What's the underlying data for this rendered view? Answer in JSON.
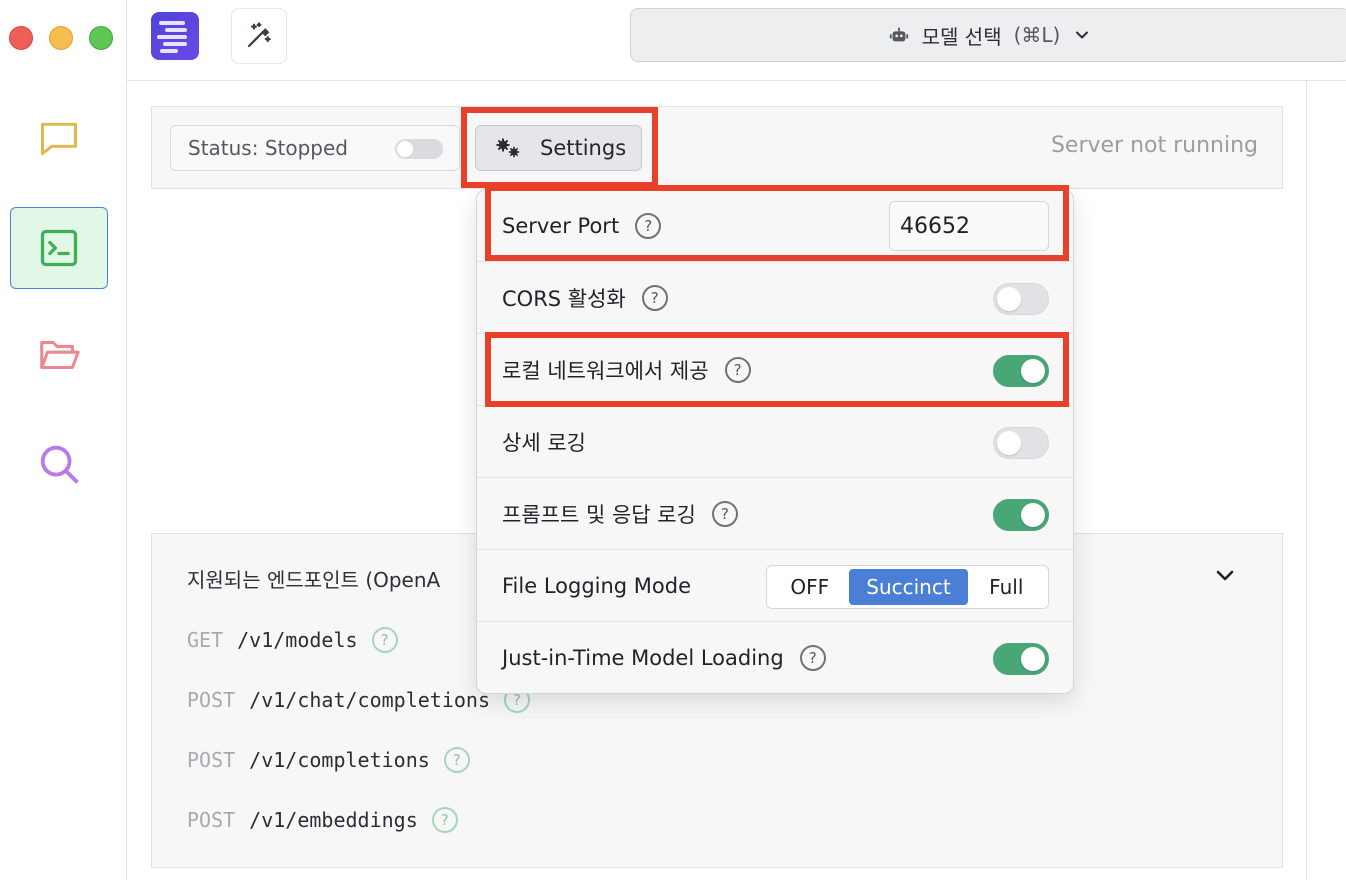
{
  "toolbar": {
    "model_select_label": "모델 선택",
    "model_select_shortcut": "(⌘L)"
  },
  "server_bar": {
    "status_label": "Status: Stopped",
    "settings_label": "Settings",
    "server_status": "Server not running"
  },
  "settings": {
    "server_port_label": "Server Port",
    "server_port_value": "46652",
    "cors_label": "CORS 활성화",
    "cors_enabled": false,
    "local_network_label": "로컬 네트워크에서 제공",
    "local_network_enabled": true,
    "verbose_logging_label": "상세 로깅",
    "verbose_logging_enabled": false,
    "prompt_logging_label": "프롬프트 및 응답 로깅",
    "prompt_logging_enabled": true,
    "file_logging_label": "File Logging Mode",
    "file_logging_options": [
      "OFF",
      "Succinct",
      "Full"
    ],
    "file_logging_selected": "Succinct",
    "jit_label": "Just-in-Time Model Loading",
    "jit_enabled": true
  },
  "endpoints": {
    "title": "지원되는 엔드포인트 (OpenA",
    "items": [
      {
        "method": "GET",
        "path": "/v1/models"
      },
      {
        "method": "POST",
        "path": "/v1/chat/completions"
      },
      {
        "method": "POST",
        "path": "/v1/completions"
      },
      {
        "method": "POST",
        "path": "/v1/embeddings"
      }
    ]
  },
  "colors": {
    "accent_green": "#4aa577",
    "accent_blue": "#4b7fd6",
    "highlight_red": "#e8402a"
  },
  "icons": {
    "help_glyph": "?"
  }
}
